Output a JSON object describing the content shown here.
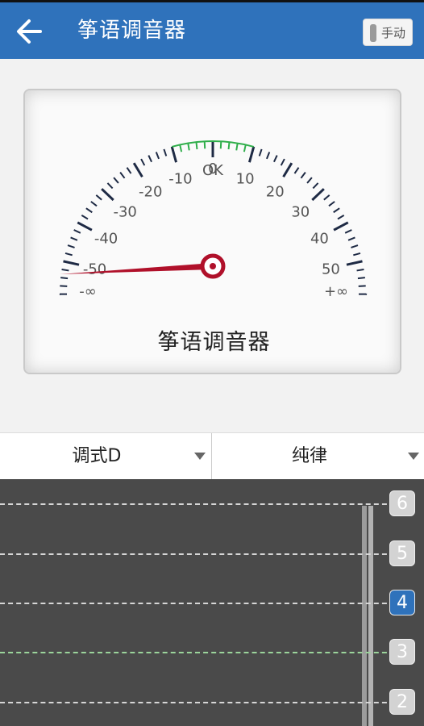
{
  "header": {
    "title": "筝语调音器",
    "mode_label": "手动"
  },
  "meter": {
    "ok_label": "OK",
    "name": "筝语调音器",
    "scale_left": [
      "-10",
      "-20",
      "-30",
      "-40",
      "-50"
    ],
    "scale_right": [
      "10",
      "20",
      "30",
      "40",
      "50"
    ],
    "zero_label": "0",
    "neg_inf_label": "-∞",
    "pos_inf_label": "+∞",
    "needle_value": -60,
    "colors": {
      "tick": "#1e2a44",
      "ok_zone": "#2fae4a",
      "needle": "#b0102a"
    }
  },
  "selectors": {
    "mode": "调式D",
    "temperament": "纯律"
  },
  "strings": [
    {
      "number": "6",
      "active": false,
      "green": false
    },
    {
      "number": "5",
      "active": false,
      "green": false
    },
    {
      "number": "4",
      "active": true,
      "green": false
    },
    {
      "number": "3",
      "active": false,
      "green": true
    },
    {
      "number": "2",
      "active": false,
      "green": false
    }
  ],
  "icons": {
    "back": "arrow-left-icon",
    "dropdown": "caret-down-icon"
  }
}
